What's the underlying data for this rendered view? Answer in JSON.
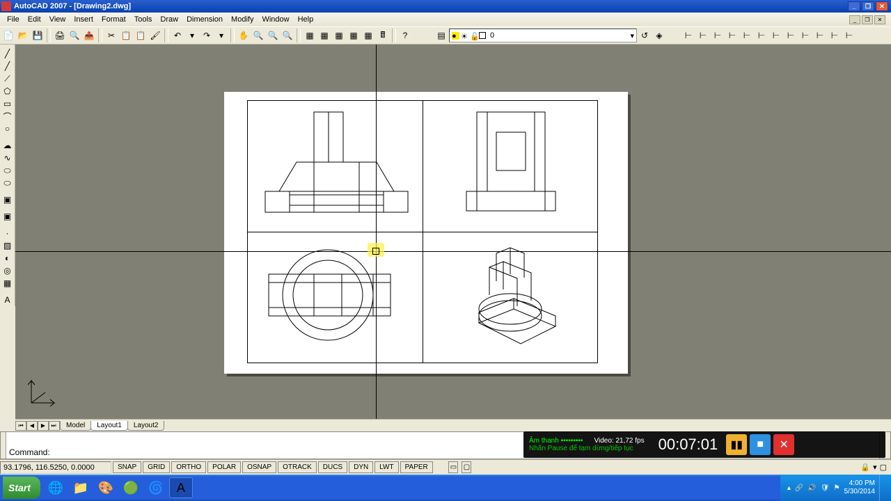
{
  "window": {
    "title": "AutoCAD 2007 - [Drawing2.dwg]"
  },
  "menu": {
    "items": [
      "File",
      "Edit",
      "View",
      "Insert",
      "Format",
      "Tools",
      "Draw",
      "Dimension",
      "Modify",
      "Window",
      "Help"
    ]
  },
  "layer_combo": {
    "current": "0"
  },
  "tabs": {
    "items": [
      "Model",
      "Layout1",
      "Layout2"
    ],
    "active": 1
  },
  "command": {
    "prompt": "Command:"
  },
  "status": {
    "coords": "93.1796, 116.5250, 0.0000",
    "toggles": [
      "SNAP",
      "GRID",
      "ORTHO",
      "POLAR",
      "OSNAP",
      "OTRACK",
      "DUCS",
      "DYN",
      "LWT",
      "PAPER"
    ]
  },
  "taskbar": {
    "start": "Start",
    "time": "4:00 PM",
    "date": "5/30/2014"
  },
  "video_overlay": {
    "audio_label": "Âm thanh",
    "video_label": "Video: 21,72 fps",
    "hint": "Nhấn Pause để tạm dừng/tiếp tục",
    "time": "00:07:01"
  }
}
